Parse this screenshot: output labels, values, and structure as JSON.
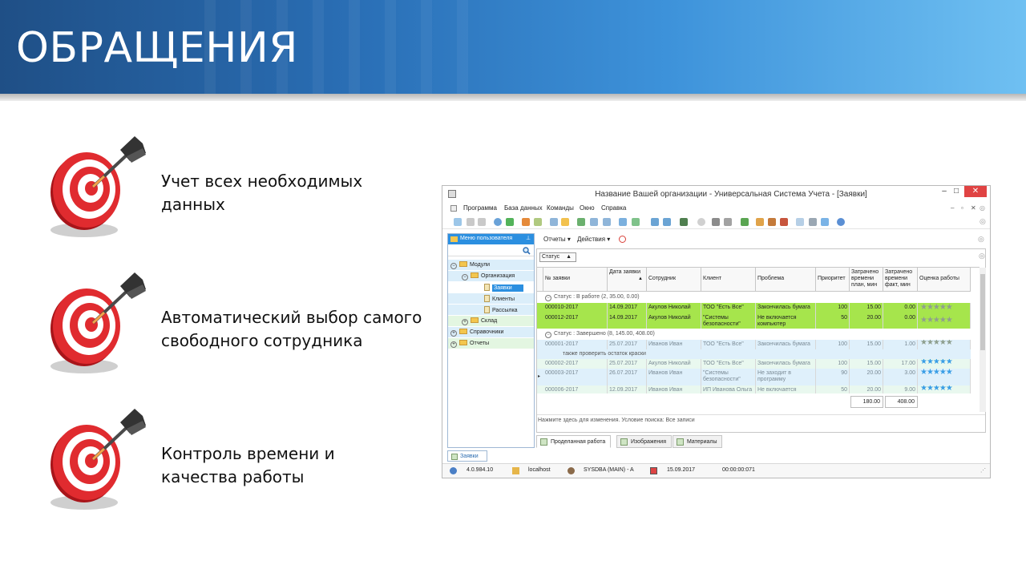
{
  "slide": {
    "title": "ОБРАЩЕНИЯ",
    "bullets": [
      {
        "line1": "Учет всех необходимых",
        "line2": "данных"
      },
      {
        "line1": "Автоматический выбор самого",
        "line2": "свободного сотрудника"
      },
      {
        "line1": "Контроль времени и",
        "line2": "качества работы"
      }
    ]
  },
  "app": {
    "window_title": "Название Вашей организации - Универсальная Система Учета - [Заявки]",
    "window_controls": {
      "minimize": "–",
      "maximize": "□",
      "close": "✕"
    },
    "menu": [
      "Программа",
      "База данных",
      "Команды",
      "Окно",
      "Справка"
    ],
    "user_menu": {
      "header": "Меню пользователя",
      "items": [
        {
          "label": "Модули"
        },
        {
          "label": "Организация"
        },
        {
          "label": "Заявки"
        },
        {
          "label": "Клиенты"
        },
        {
          "label": "Рассылка"
        },
        {
          "label": "Склад"
        },
        {
          "label": "Справочники"
        },
        {
          "label": "Отчеты"
        }
      ]
    },
    "panel_toolbar": {
      "reports": "Отчеты ▾",
      "actions": "Действия ▾"
    },
    "group_by": "Статус",
    "columns": [
      "№ заявки",
      "Дата заявки",
      "Сотрудник",
      "Клиент",
      "Проблема",
      "Приоритет",
      "Затрачено времени план, мин",
      "Затрачено времени факт, мин",
      "Оценка работы"
    ],
    "groups": [
      {
        "label": "Статус : В работе (2, 35.00, 0.00)",
        "rows": [
          {
            "num": "000010-2017",
            "date": "14.09.2017",
            "employee": "Акулов Николай",
            "client": "ТОО \"Есть Все\"",
            "problem": "Закончилась бумага",
            "priority": "100",
            "plan": "15.00",
            "fact": "0.00",
            "stars": "★★★★★"
          },
          {
            "num": "000012-2017",
            "date": "14.09.2017",
            "employee": "Акулов Николай",
            "client": "\"Системы безопасности\"",
            "problem": "Не включается компьютер",
            "priority": "50",
            "plan": "20.00",
            "fact": "0.00",
            "stars": "★★★★★"
          }
        ]
      },
      {
        "label": "Статус : Завершено (8, 145.00, 408.00)",
        "rows": [
          {
            "num": "000001-2017",
            "date": "25.07.2017",
            "employee": "Иванов Иван",
            "client": "ТОО \"Есть Все\"",
            "problem": "Закончилась бумага",
            "priority": "100",
            "plan": "15.00",
            "fact": "1.00",
            "stars": "★★★★★"
          },
          {
            "num": "000002-2017",
            "date": "25.07.2017",
            "employee": "Акулов Николай",
            "client": "ТОО \"Есть Все\"",
            "problem": "Закончилась бумага",
            "priority": "100",
            "plan": "15.00",
            "fact": "17.00",
            "stars": "★★★★★"
          },
          {
            "num": "000003-2017",
            "date": "26.07.2017",
            "employee": "Иванов Иван",
            "client": "\"Системы безопасности\"",
            "problem": "Не заходит в программу",
            "priority": "90",
            "plan": "20.00",
            "fact": "3.00",
            "stars": "★★★★★"
          },
          {
            "num": "000006-2017",
            "date": "12.09.2017",
            "employee": "Иванов Иван",
            "client": "ИП Иванова Ольга",
            "problem": "Не включается",
            "priority": "50",
            "plan": "20.00",
            "fact": "9.00",
            "stars": "★★★★★"
          }
        ]
      }
    ],
    "preview_note": "также проверить остаток краски",
    "totals": {
      "plan": "180.00",
      "fact": "408.00"
    },
    "status_line": "Нажмите здесь для изменения. Условие поиска: Все записи",
    "bottom_tabs": [
      "Проделанная работа",
      "Изображения",
      "Материалы"
    ],
    "left_tab": "Заявки",
    "statusbar": {
      "version": "4.0.984.10",
      "server": "localhost",
      "user": "SYSDBA (MAIN) - A",
      "date": "15.09.2017",
      "timer": "00:00:00:071"
    }
  },
  "colors": {
    "banner_start": "#1f4f86",
    "banner_end": "#6fc0f2",
    "target_red": "#d8262b",
    "row_green": "#a6e54c",
    "star_blue": "#3a9ee6",
    "menu_blue": "#2b8fe0"
  }
}
